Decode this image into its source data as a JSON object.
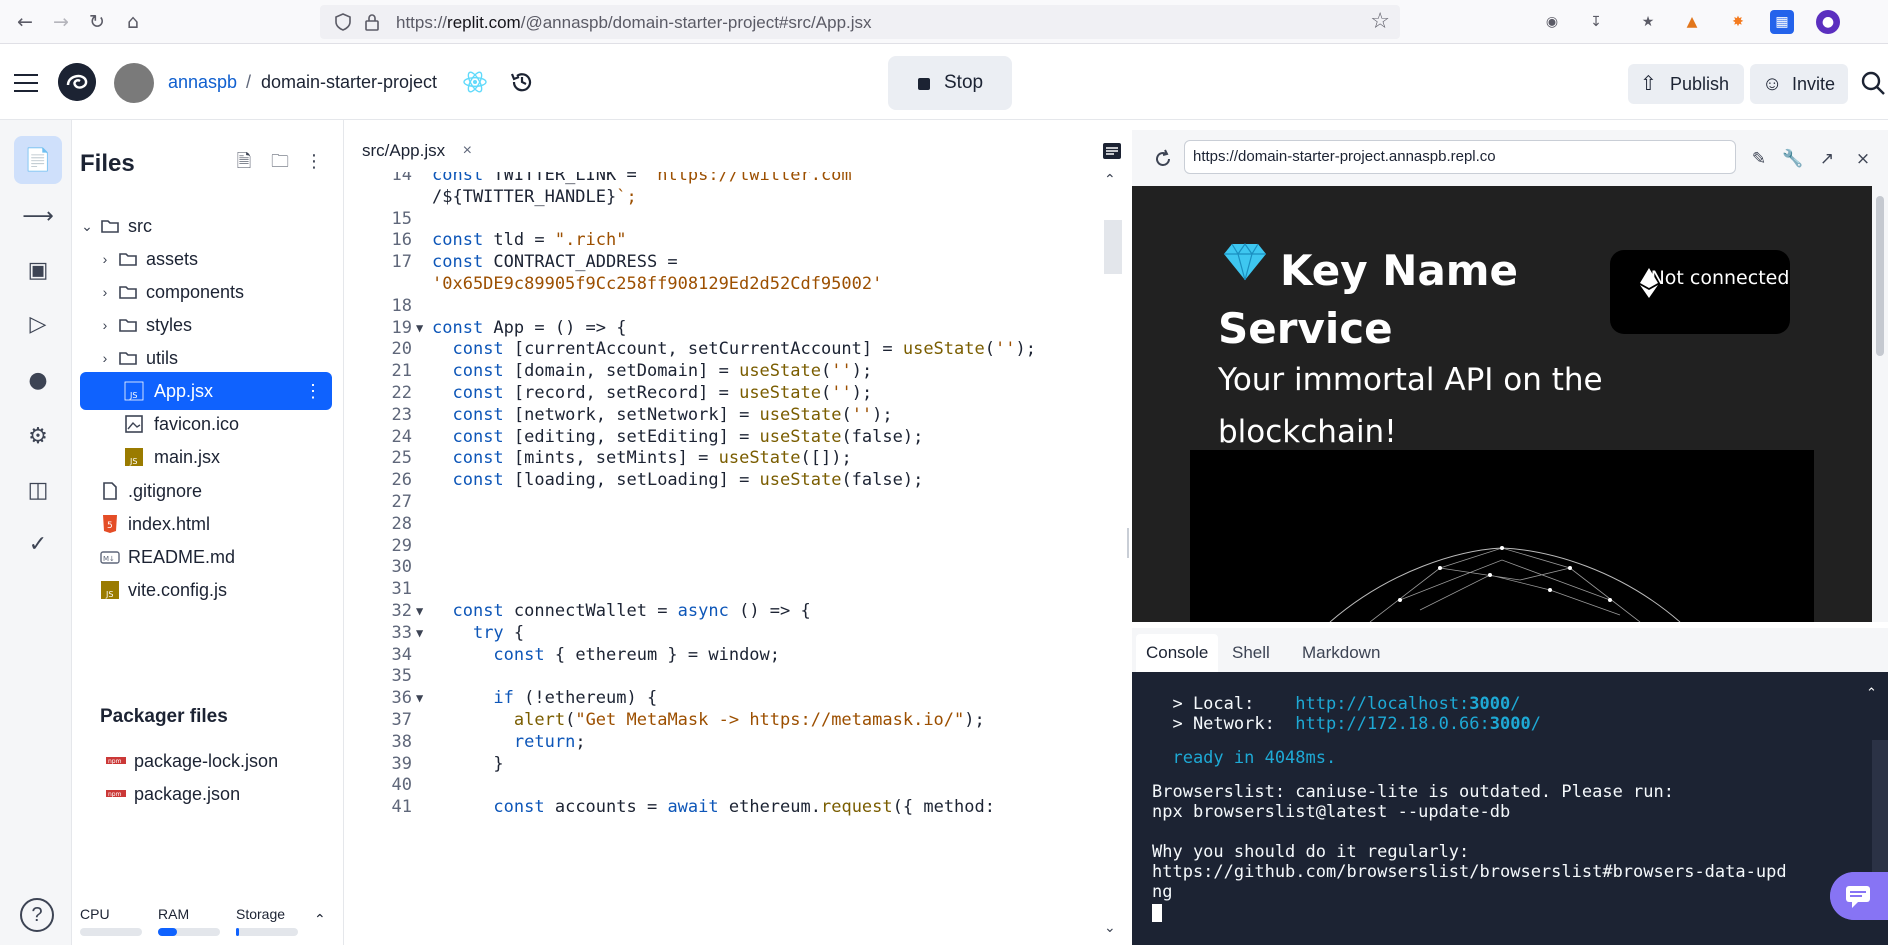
{
  "browser": {
    "url_prefix": "https://",
    "url_domain": "replit.com",
    "url_path": "/@annaspb/domain-starter-project#src/App.jsx"
  },
  "header": {
    "user": "annaspb",
    "separator": "/",
    "project": "domain-starter-project",
    "stop_label": "Stop",
    "publish_label": "Publish",
    "invite_label": "Invite"
  },
  "files": {
    "title": "Files",
    "tree": [
      {
        "name": "src",
        "type": "folder",
        "open": true,
        "depth": 0
      },
      {
        "name": "assets",
        "type": "folder",
        "open": false,
        "depth": 1
      },
      {
        "name": "components",
        "type": "folder",
        "open": false,
        "depth": 1
      },
      {
        "name": "styles",
        "type": "folder",
        "open": false,
        "depth": 1
      },
      {
        "name": "utils",
        "type": "folder",
        "open": false,
        "depth": 1
      },
      {
        "name": "App.jsx",
        "type": "js",
        "depth": 1,
        "selected": true
      },
      {
        "name": "favicon.ico",
        "type": "image",
        "depth": 1
      },
      {
        "name": "main.jsx",
        "type": "js",
        "depth": 1
      },
      {
        "name": ".gitignore",
        "type": "file",
        "depth": 0
      },
      {
        "name": "index.html",
        "type": "html",
        "depth": 0
      },
      {
        "name": "README.md",
        "type": "md",
        "depth": 0
      },
      {
        "name": "vite.config.js",
        "type": "js",
        "depth": 0
      }
    ],
    "packager_title": "Packager files",
    "packager": [
      "package-lock.json",
      "package.json"
    ],
    "resources": {
      "cpu": "CPU",
      "ram": "RAM",
      "storage": "Storage",
      "cpu_level": 0.0,
      "ram_level": 0.3,
      "storage_level": 0.05
    }
  },
  "editor": {
    "tab_label": "src/App.jsx",
    "lines": [
      {
        "n": "14",
        "text": "const TWITTER_LINK = `https://twitter.com"
      },
      {
        "n": "",
        "text": "/${TWITTER_HANDLE}`;"
      },
      {
        "n": "15",
        "text": ""
      },
      {
        "n": "16",
        "text": "const tld = \".rich\""
      },
      {
        "n": "17",
        "text": "const CONTRACT_ADDRESS ="
      },
      {
        "n": "",
        "text": "'0x65DE9c89905f9Cc258ff908129Ed2d52Cdf95002'"
      },
      {
        "n": "18",
        "text": ""
      },
      {
        "n": "19",
        "text": "const App = () => {",
        "fold": true
      },
      {
        "n": "20",
        "text": "  const [currentAccount, setCurrentAccount] = useState('');"
      },
      {
        "n": "21",
        "text": "  const [domain, setDomain] = useState('');"
      },
      {
        "n": "22",
        "text": "  const [record, setRecord] = useState('');"
      },
      {
        "n": "23",
        "text": "  const [network, setNetwork] = useState('');"
      },
      {
        "n": "24",
        "text": "  const [editing, setEditing] = useState(false);"
      },
      {
        "n": "25",
        "text": "  const [mints, setMints] = useState([]);"
      },
      {
        "n": "26",
        "text": "  const [loading, setLoading] = useState(false);"
      },
      {
        "n": "27",
        "text": ""
      },
      {
        "n": "28",
        "text": ""
      },
      {
        "n": "29",
        "text": ""
      },
      {
        "n": "30",
        "text": ""
      },
      {
        "n": "31",
        "text": ""
      },
      {
        "n": "32",
        "text": "  const connectWallet = async () => {",
        "fold": true
      },
      {
        "n": "33",
        "text": "    try {",
        "fold": true
      },
      {
        "n": "34",
        "text": "      const { ethereum } = window;"
      },
      {
        "n": "35",
        "text": ""
      },
      {
        "n": "36",
        "text": "      if (!ethereum) {",
        "fold": true
      },
      {
        "n": "37",
        "text": "        alert(\"Get MetaMask -> https://metamask.io/\");"
      },
      {
        "n": "38",
        "text": "        return;"
      },
      {
        "n": "39",
        "text": "      }"
      },
      {
        "n": "40",
        "text": ""
      },
      {
        "n": "41",
        "text": "      const accounts = await ethereum.request({ method:"
      }
    ]
  },
  "webview": {
    "url": "https://domain-starter-project.annaspb.repl.co",
    "title": "Key Name Service",
    "subtitle": "Your immortal API on the blockchain!",
    "connect_label": "Not connected"
  },
  "console": {
    "tabs": [
      "Console",
      "Shell",
      "Markdown"
    ],
    "active_tab": "Console",
    "local_label": "  > Local:    ",
    "local_url_a": "http://localhost:",
    "local_url_port": "3000",
    "local_url_b": "/",
    "network_label": "  > Network:  ",
    "network_url_a": "http://172.18.0.66:",
    "network_url_port": "3000",
    "network_url_b": "/",
    "ready": "  ready in 4048ms.",
    "msg1": "Browserslist: caniuse-lite is outdated. Please run:",
    "msg2": "npx browserslist@latest --update-db",
    "msg3": "Why you should do it regularly:",
    "msg4": "https://github.com/browserslist/browserslist#browsers-data-upd",
    "msg5": "ng"
  },
  "colors": {
    "accent": "#0f62fe",
    "console_bg": "#1c2333",
    "webview_bg": "#212121",
    "chat": "#8774f4"
  }
}
